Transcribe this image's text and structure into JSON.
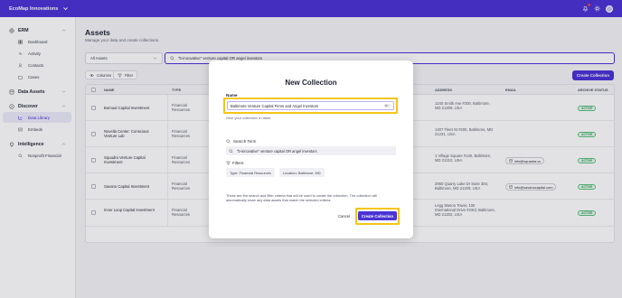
{
  "app": {
    "brand": "EcoMap Innovations"
  },
  "sidebar": {
    "sections": [
      {
        "label": "ERM",
        "items": [
          "Dashboard",
          "Activity",
          "Contacts",
          "Cases"
        ]
      },
      {
        "label": "Data Assets",
        "items": []
      },
      {
        "label": "Discover",
        "items": [
          "Data Library",
          "Embeds"
        ]
      },
      {
        "label": "Intelligence",
        "items": [
          "Nonprofit Financial"
        ]
      }
    ],
    "active_item": "Data Library"
  },
  "page": {
    "title": "Assets",
    "subtitle": "Manage your data and create collections."
  },
  "filter": {
    "select_value": "All Assets",
    "search_value": "\"b-innovative\" venture capital OR angel investors"
  },
  "toolbar": {
    "columns_label": "Columns",
    "filter_label": "Filter",
    "create_collection_label": "Create Collection"
  },
  "table": {
    "headers": [
      "NAME",
      "TYPE",
      "ADDRESS",
      "EMAIL",
      "ARCHIVE STATUS"
    ],
    "rows": [
      {
        "name": "Bornual Capital Investment",
        "type": "Financial Resources",
        "address": "1240 Smith Ave #200, Baltimore, MD 21209, USA",
        "email": "",
        "status": "ACTIVE"
      },
      {
        "name": "Novella Center: Conscious Venture Lab",
        "type": "Financial Resources",
        "address": "1407 Fleet St #200, Baltimore, MD 21231, USA",
        "email": "",
        "status": "ACTIVE"
      },
      {
        "name": "Squadra Venture Capital Investment",
        "type": "Financial Resources",
        "address": "1 Village Square #130, Baltimore, MD 21210, USA",
        "email": "info@squadra.vc",
        "status": "ACTIVE"
      },
      {
        "name": "Savano Capital Investment",
        "type": "Financial Resources",
        "address": "2850 Quarry Lake Dr Suite 304, Baltimore, MD 21209, USA",
        "email": "info@savanocapital.com",
        "status": "ACTIVE"
      },
      {
        "name": "Inner Loop Capital Investment",
        "type": "Financial Resources",
        "address": "Legg Mason Tower, 100 International Drive #23rd, Baltimore, MD 21202, USA",
        "email": "",
        "status": "ACTIVE"
      }
    ]
  },
  "modal": {
    "title": "New Collection",
    "name_label": "Name",
    "name_value": "Baltimore Venture Capital Firms and Angel Investors",
    "name_help": "Give your collection a name",
    "search_term_label": "Search Term",
    "search_term_value": "\"b-innovative\" venture capital OR angel investors",
    "filters_label": "Filters:",
    "filters": [
      "Type: Financial Resources",
      "Location: Baltimore, MD"
    ],
    "note": "These are the search and filter criteria that will be used to create the collection. The collection will automatically show any data assets that match the selected criteria.",
    "cancel_label": "Cancel",
    "create_label": "Create Collection"
  },
  "colors": {
    "accent": "#4a33d6",
    "highlight": "#f5c518",
    "active_status": "#2d9b53"
  }
}
